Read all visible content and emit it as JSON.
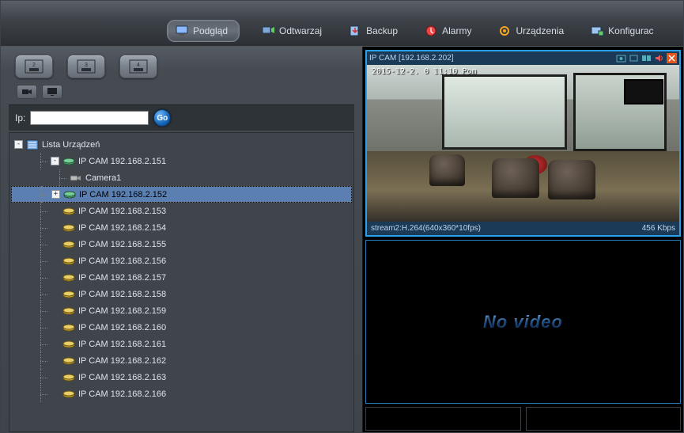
{
  "tabs": {
    "preview": "Podgląd",
    "playback": "Odtwarzaj",
    "backup": "Backup",
    "alarms": "Alarmy",
    "devices": "Urządzenia",
    "config": "Konfigurac"
  },
  "sidebar": {
    "ip_label": "Ip:",
    "ip_value": "",
    "go_label": "Go",
    "root_label": "Lista Urządzeń",
    "devices": [
      {
        "label": "IP CAM 192.168.2.151",
        "online": true,
        "expanded": true,
        "children": [
          {
            "label": "Camera1"
          }
        ]
      },
      {
        "label": "IP CAM 192.168.2.152",
        "online": true,
        "selected": true
      },
      {
        "label": "IP CAM 192.168.2.153",
        "online": false
      },
      {
        "label": "IP CAM 192.168.2.154",
        "online": false
      },
      {
        "label": "IP CAM 192.168.2.155",
        "online": false
      },
      {
        "label": "IP CAM 192.168.2.156",
        "online": false
      },
      {
        "label": "IP CAM 192.168.2.157",
        "online": false
      },
      {
        "label": "IP CAM 192.168.2.158",
        "online": false
      },
      {
        "label": "IP CAM 192.168.2.159",
        "online": false
      },
      {
        "label": "IP CAM 192.168.2.160",
        "online": false
      },
      {
        "label": "IP CAM 192.168.2.161",
        "online": false
      },
      {
        "label": "IP CAM 192.168.2.162",
        "online": false
      },
      {
        "label": "IP CAM 192.168.2.163",
        "online": false
      },
      {
        "label": "IP CAM 192.168.2.166",
        "online": false
      }
    ]
  },
  "video": {
    "tile1": {
      "title": "IP CAM [192.168.2.202]",
      "stream_info": "stream2:H.264(640x360*10fps)",
      "bitrate": "456 Kbps",
      "timestamp": "2015-12-2.  0 11:10 Pom"
    },
    "novideo_text": "No video"
  }
}
